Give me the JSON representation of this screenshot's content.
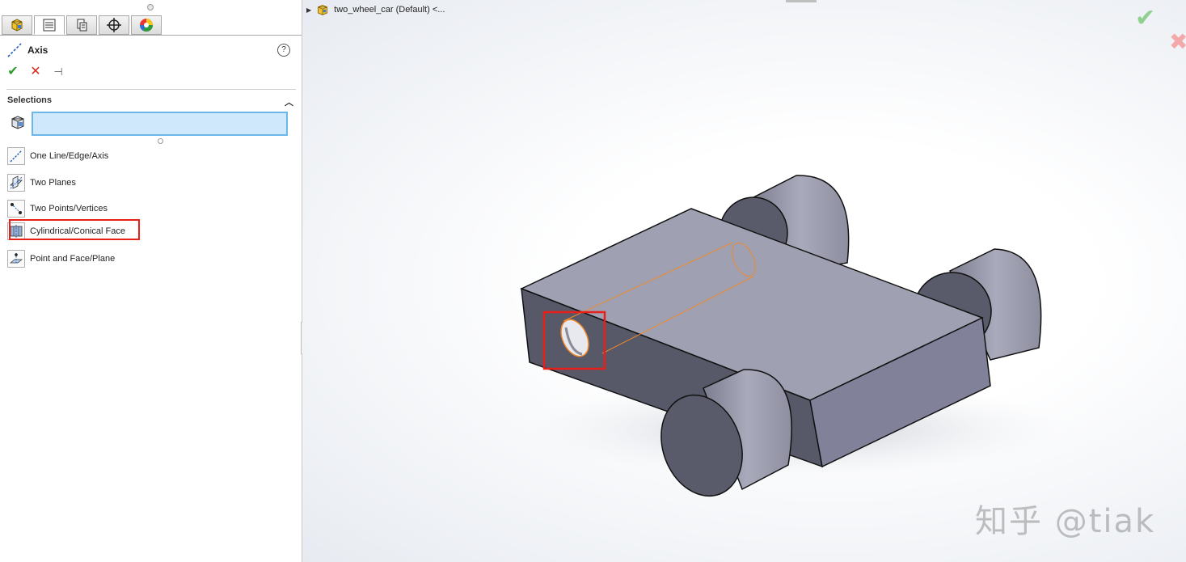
{
  "property_manager": {
    "tabs": [
      {
        "icon": "feature-manager-icon"
      },
      {
        "icon": "property-manager-icon"
      },
      {
        "icon": "configuration-manager-icon"
      },
      {
        "icon": "dimxpert-manager-icon"
      },
      {
        "icon": "display-manager-icon"
      }
    ],
    "title": "Axis",
    "help_label": "?",
    "ok_label": "✔",
    "cancel_label": "✕",
    "pin_label": "⊣",
    "selections_header": "Selections",
    "selection_value": "",
    "options": [
      {
        "label": "One Line/Edge/Axis",
        "icon": "line-edge-axis-icon"
      },
      {
        "label": "Two Planes",
        "icon": "two-planes-icon"
      },
      {
        "label": "Two Points/Vertices",
        "icon": "two-points-icon"
      },
      {
        "label": "Cylindrical/Conical Face",
        "icon": "cylindrical-face-icon",
        "highlighted": true
      },
      {
        "label": "Point and Face/Plane",
        "icon": "point-face-icon"
      }
    ]
  },
  "viewport": {
    "tree_label": "two_wheel_car (Default) <...",
    "ok_label": "✔",
    "cancel_label": "✖"
  },
  "watermark": "知乎 @tiak",
  "colors": {
    "highlight_box": "#e8201a",
    "selection_box_fill": "#cfe8fb",
    "selection_box_border": "#6cb7e8",
    "body_top": "#9fa0b2",
    "body_front": "#575868",
    "wheel_face": "#5a5b6a",
    "hidden_cylinder": "#f08a2c"
  }
}
